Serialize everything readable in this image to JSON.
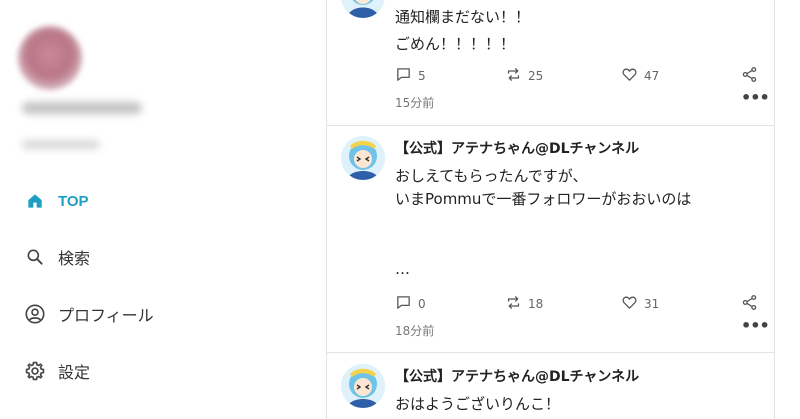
{
  "sidebar": {
    "nav": [
      {
        "label": "TOP",
        "icon": "home-icon",
        "active": true
      },
      {
        "label": "検索",
        "icon": "search-icon",
        "active": false
      },
      {
        "label": "プロフィール",
        "icon": "user-circle-icon",
        "active": false
      },
      {
        "label": "設定",
        "icon": "gear-icon",
        "active": false
      }
    ],
    "accent_color": "#1d9fc4"
  },
  "feed": {
    "posts": [
      {
        "author": "",
        "lines": [
          "通知欄まだない！！",
          "ごめん！！！！！"
        ],
        "comments": "5",
        "reposts": "25",
        "likes": "47",
        "time": "15分前"
      },
      {
        "author": "【公式】アテナちゃん@DLチャンネル",
        "lines": [
          "おしえてもらったんですが、",
          "いまPommuで一番フォロワーがおおいのは",
          "",
          "…"
        ],
        "comments": "0",
        "reposts": "18",
        "likes": "31",
        "time": "18分前"
      },
      {
        "author": "【公式】アテナちゃん@DLチャンネル",
        "lines": [
          "おはようございりんこ！"
        ],
        "comments": "",
        "reposts": "",
        "likes": "",
        "time": ""
      }
    ]
  }
}
